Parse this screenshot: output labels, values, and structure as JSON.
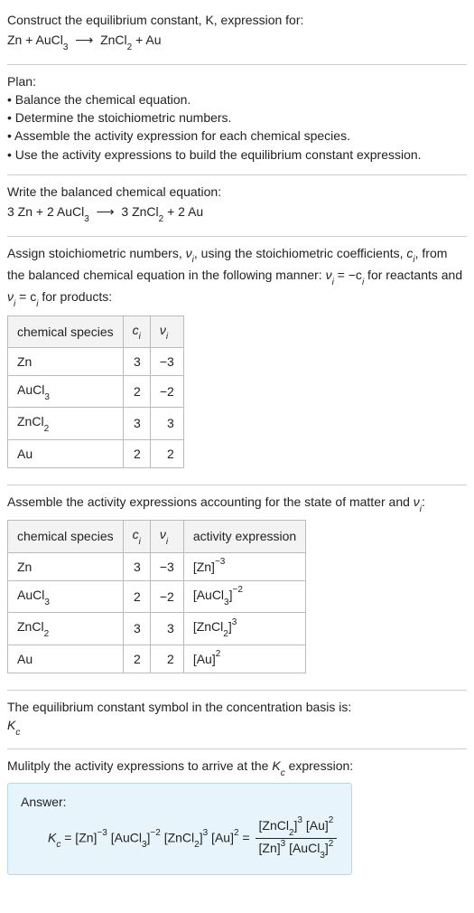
{
  "intro": {
    "line1": "Construct the equilibrium constant, K, expression for:",
    "equation_lhs": "Zn + AuCl",
    "equation_rhs": "ZnCl",
    "equation_tail": " + Au"
  },
  "plan": {
    "heading": "Plan:",
    "b1": "• Balance the chemical equation.",
    "b2": "• Determine the stoichiometric numbers.",
    "b3": "• Assemble the activity expression for each chemical species.",
    "b4": "• Use the activity expressions to build the equilibrium constant expression."
  },
  "balanced": {
    "heading": "Write the balanced chemical equation:",
    "text": "3 Zn + 2 AuCl",
    "mid": "3 ZnCl",
    "tail": " + 2 Au"
  },
  "stoich": {
    "heading_a": "Assign stoichiometric numbers, ",
    "heading_b": ", using the stoichiometric coefficients, ",
    "heading_c": ", from the balanced chemical equation in the following manner: ",
    "heading_d": " for reactants and ",
    "heading_e": " for products:",
    "nu": "ν",
    "c": "c",
    "eq1a": "ν",
    "eq1b": " = −c",
    "eq2a": "ν",
    "eq2b": " = c",
    "th1": "chemical species",
    "th2": "c",
    "th3": "ν",
    "rows": [
      {
        "sp": "Zn",
        "c": "3",
        "v": "−3"
      },
      {
        "sp": "AuCl",
        "sub": "3",
        "c": "2",
        "v": "−2"
      },
      {
        "sp": "ZnCl",
        "sub": "2",
        "c": "3",
        "v": "3"
      },
      {
        "sp": "Au",
        "c": "2",
        "v": "2"
      }
    ]
  },
  "activity": {
    "heading_a": "Assemble the activity expressions accounting for the state of matter and ",
    "heading_b": ":",
    "th1": "chemical species",
    "th2": "c",
    "th3": "ν",
    "th4": "activity expression",
    "rows": [
      {
        "sp": "Zn",
        "c": "3",
        "v": "−3",
        "act": "[Zn]",
        "exp": "−3"
      },
      {
        "sp": "AuCl",
        "sub": "3",
        "c": "2",
        "v": "−2",
        "act": "[AuCl",
        "asub": "3",
        "aclose": "]",
        "exp": "−2"
      },
      {
        "sp": "ZnCl",
        "sub": "2",
        "c": "3",
        "v": "3",
        "act": "[ZnCl",
        "asub": "2",
        "aclose": "]",
        "exp": "3"
      },
      {
        "sp": "Au",
        "c": "2",
        "v": "2",
        "act": "[Au]",
        "exp": "2"
      }
    ]
  },
  "basis": {
    "line1": "The equilibrium constant symbol in the concentration basis is:",
    "sym": "K",
    "sub": "c"
  },
  "multiply": {
    "line": "Mulitply the activity expressions to arrive at the ",
    "sym": "K",
    "sub": "c",
    "tail": " expression:"
  },
  "answer": {
    "label": "Answer:",
    "Kc": "K",
    "Kc_sub": "c",
    "eq": " = [Zn]",
    "e1": "−3",
    "t2": " [AuCl",
    "s2": "3",
    "t2c": "]",
    "e2": "−2",
    "t3": " [ZnCl",
    "s3": "2",
    "t3c": "]",
    "e3": "3",
    "t4": " [Au]",
    "e4": "2",
    "eq2": " = ",
    "num_a": "[ZnCl",
    "num_as": "2",
    "num_ac": "]",
    "num_ae": "3",
    "num_b": " [Au]",
    "num_be": "2",
    "den_a": "[Zn]",
    "den_ae": "3",
    "den_b": " [AuCl",
    "den_bs": "3",
    "den_bc": "]",
    "den_be": "2"
  },
  "chart_data": {
    "type": "table",
    "tables": [
      {
        "title": "stoichiometric numbers",
        "columns": [
          "chemical species",
          "c_i",
          "ν_i"
        ],
        "rows": [
          [
            "Zn",
            3,
            -3
          ],
          [
            "AuCl3",
            2,
            -2
          ],
          [
            "ZnCl2",
            3,
            3
          ],
          [
            "Au",
            2,
            2
          ]
        ]
      },
      {
        "title": "activity expressions",
        "columns": [
          "chemical species",
          "c_i",
          "ν_i",
          "activity expression"
        ],
        "rows": [
          [
            "Zn",
            3,
            -3,
            "[Zn]^-3"
          ],
          [
            "AuCl3",
            2,
            -2,
            "[AuCl3]^-2"
          ],
          [
            "ZnCl2",
            3,
            3,
            "[ZnCl2]^3"
          ],
          [
            "Au",
            2,
            2,
            "[Au]^2"
          ]
        ]
      }
    ]
  }
}
